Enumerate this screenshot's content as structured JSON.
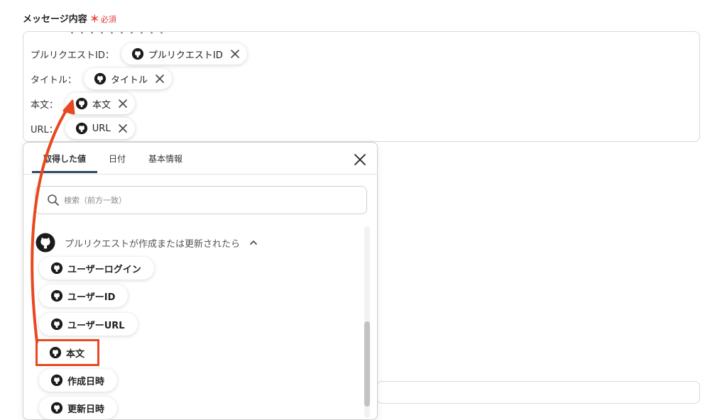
{
  "field": {
    "label": "メッセージ内容",
    "required_mark": "＊",
    "required_text": "必須"
  },
  "editor": {
    "clipped_text": "・・・・・・・・・・",
    "lines": [
      {
        "label": "プルリクエストID：",
        "chip": "プルリクエストID"
      },
      {
        "label": "タイトル：",
        "chip": "タイトル"
      },
      {
        "label": "本文：",
        "chip": "本文"
      },
      {
        "label": "URL：",
        "chip": "URL"
      }
    ]
  },
  "panel": {
    "tabs": [
      "取得した値",
      "日付",
      "基本情報"
    ],
    "active_tab": "取得した値",
    "search_placeholder": "検索（前方一致）",
    "group_title": "プルリクエストが作成または更新されたら",
    "items": [
      "ユーザーログイン",
      "ユーザーID",
      "ユーザーURL",
      "本文",
      "作成日時",
      "更新日時"
    ],
    "highlighted_item": "本文"
  },
  "colors": {
    "accent_red": "#e8481f",
    "required_red": "#e5383b",
    "tab_underline": "#2e4a63"
  }
}
